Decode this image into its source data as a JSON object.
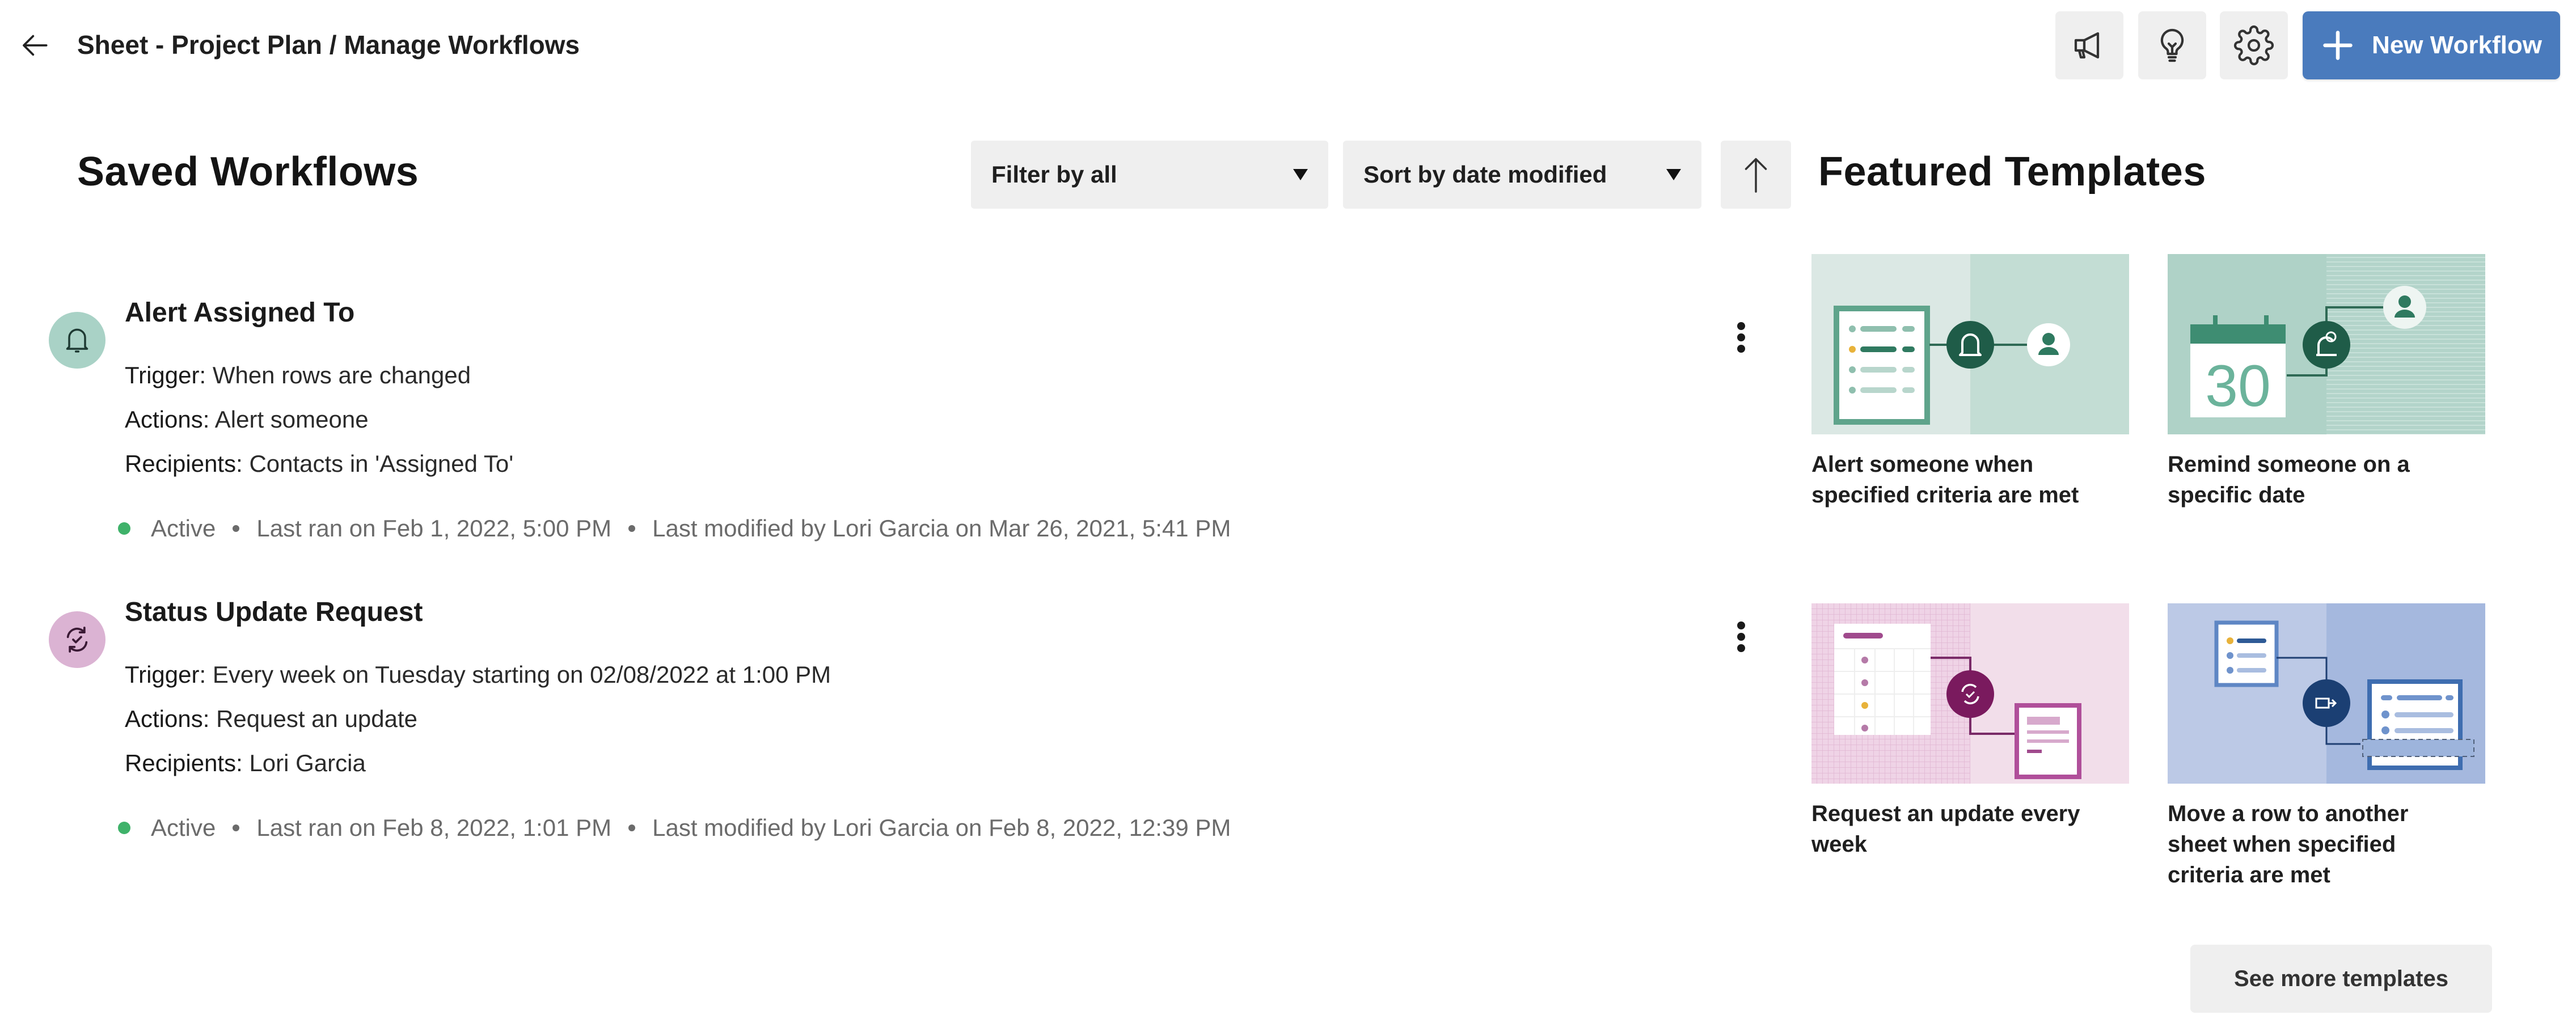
{
  "header": {
    "breadcrumb": "Sheet - Project Plan / Manage Workflows",
    "icons": [
      "back-arrow-icon",
      "megaphone-icon",
      "lightbulb-icon",
      "gear-icon",
      "plus-icon"
    ],
    "new_workflow_label": "New Workflow",
    "accent_color": "#4a7bbd"
  },
  "saved": {
    "title": "Saved Workflows",
    "filter": {
      "selected": "Filter by all"
    },
    "sort": {
      "selected": "Sort by date modified",
      "direction": "ascending"
    },
    "workflows": [
      {
        "icon": "bell-icon",
        "icon_bg": "#a9d2c6",
        "name": "Alert Assigned To",
        "trigger_label": "Trigger:",
        "trigger": "When rows are changed",
        "actions_label": "Actions:",
        "actions": "Alert someone",
        "recipients_label": "Recipients:",
        "recipients": "Contacts in 'Assigned To'",
        "status": "Active",
        "last_ran": "Last ran on Feb 1, 2022, 5:00 PM",
        "last_modified": "Last modified by Lori Garcia on Mar 26, 2021, 5:41 PM"
      },
      {
        "icon": "refresh-check-icon",
        "icon_bg": "#dbb3d3",
        "name": "Status Update Request",
        "trigger_label": "Trigger:",
        "trigger": "Every week on Tuesday starting on 02/08/2022 at 1:00 PM",
        "actions_label": "Actions:",
        "actions": "Request an update",
        "recipients_label": "Recipients:",
        "recipients": "Lori Garcia",
        "status": "Active",
        "last_ran": "Last ran on Feb 8, 2022, 1:01 PM",
        "last_modified": "Last modified by Lori Garcia on Feb 8, 2022, 12:39 PM"
      }
    ]
  },
  "featured": {
    "title": "Featured Templates",
    "templates": [
      {
        "caption": "Alert someone when specified criteria are met",
        "theme": "green",
        "illustration": "sheet-bell-person"
      },
      {
        "caption": "Remind someone on a specific date",
        "theme": "green",
        "illustration": "calendar-30-bell-person",
        "calendar_day": "30"
      },
      {
        "caption": "Request an update every week",
        "theme": "purple",
        "illustration": "grid-refresh-form"
      },
      {
        "caption": "Move a row to another sheet when specified criteria are met",
        "theme": "blue",
        "illustration": "sheet-move-sheet"
      }
    ],
    "see_more_label": "See more templates"
  }
}
